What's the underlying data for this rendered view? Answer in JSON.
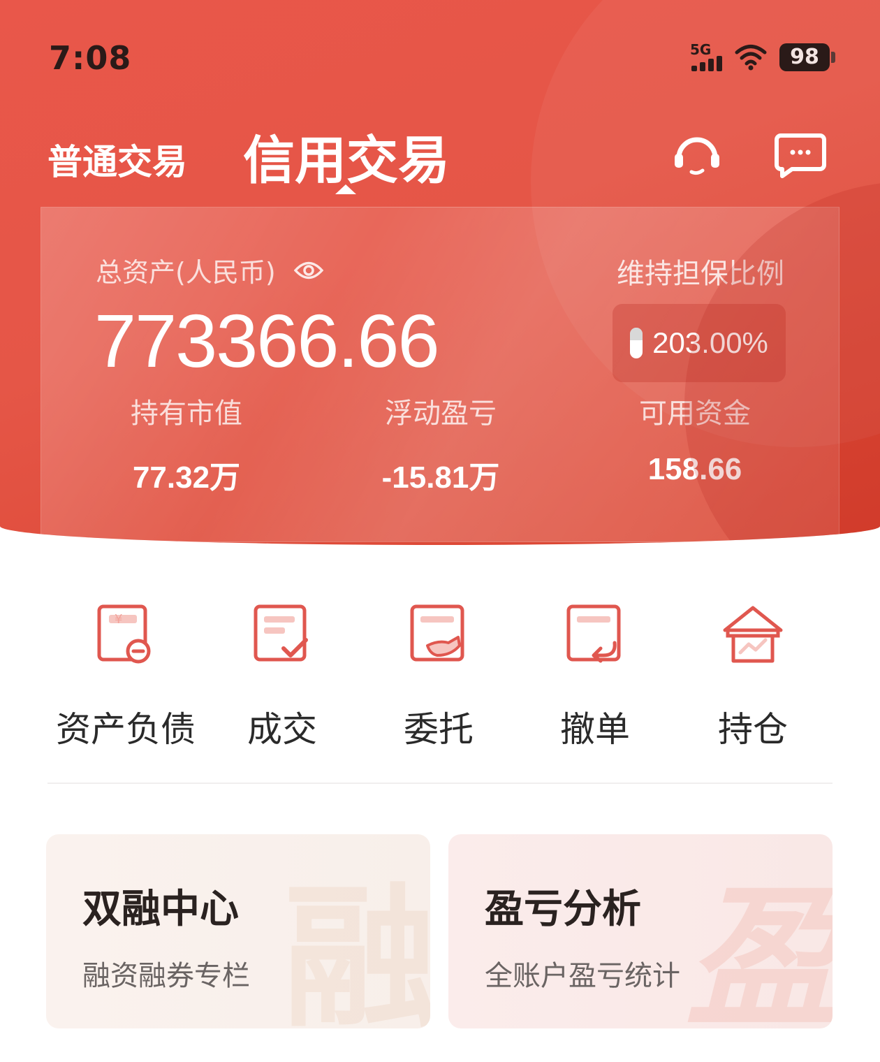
{
  "status_bar": {
    "time": "7:08",
    "network": "5G",
    "battery": "98"
  },
  "tabs": {
    "normal": "普通交易",
    "credit": "信用交易",
    "active": "credit"
  },
  "header_icons": [
    "customer-service-headset-icon",
    "message-chat-icon"
  ],
  "assets": {
    "total_label": "总资产(人民币)",
    "total_value": "773366.66",
    "ratio_label": "维持担保比例",
    "ratio_value": "203.00%",
    "stats": [
      {
        "label": "持有市值",
        "value": "77.32万"
      },
      {
        "label": "浮动盈亏",
        "value": "-15.81万"
      },
      {
        "label": "可用资金",
        "value": "158.66"
      }
    ]
  },
  "actions": [
    {
      "label": "资产负债",
      "icon": "asset-liability-icon"
    },
    {
      "label": "成交",
      "icon": "deal-check-icon"
    },
    {
      "label": "委托",
      "icon": "entrust-hand-icon"
    },
    {
      "label": "撤单",
      "icon": "cancel-order-icon"
    },
    {
      "label": "持仓",
      "icon": "holding-house-icon"
    }
  ],
  "feature_cards": [
    {
      "title": "双融中心",
      "subtitle": "融资融券专栏"
    },
    {
      "title": "盈亏分析",
      "subtitle": "全账户盈亏统计"
    }
  ],
  "colors": {
    "brand_red": "#e55647",
    "icon_red": "#e0574f",
    "text_dark": "#2a2a2a"
  }
}
